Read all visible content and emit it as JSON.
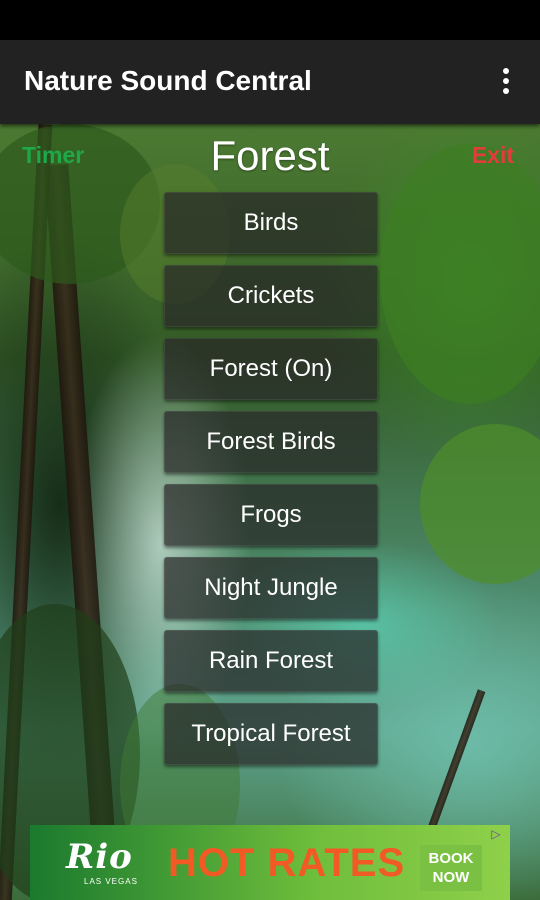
{
  "app_bar": {
    "title": "Nature Sound Central",
    "menu_icon": "more-vertical-icon"
  },
  "header": {
    "timer_label": "Timer",
    "exit_label": "Exit",
    "title": "Forest"
  },
  "sounds": [
    {
      "label": "Birds"
    },
    {
      "label": "Crickets"
    },
    {
      "label": "Forest (On)"
    },
    {
      "label": "Forest Birds"
    },
    {
      "label": "Frogs"
    },
    {
      "label": "Night Jungle"
    },
    {
      "label": "Rain Forest"
    },
    {
      "label": "Tropical Forest"
    }
  ],
  "ad": {
    "brand": "Rio",
    "brand_sub": "LAS VEGAS",
    "headline": "HOT RATES",
    "cta_line1": "BOOK",
    "cta_line2": "NOW",
    "choices_icon": "ad-choices-icon"
  },
  "colors": {
    "timer": "#1fa84a",
    "exit": "#e23c3c",
    "app_bar": "#222222",
    "ad_headline": "#f15a24"
  }
}
